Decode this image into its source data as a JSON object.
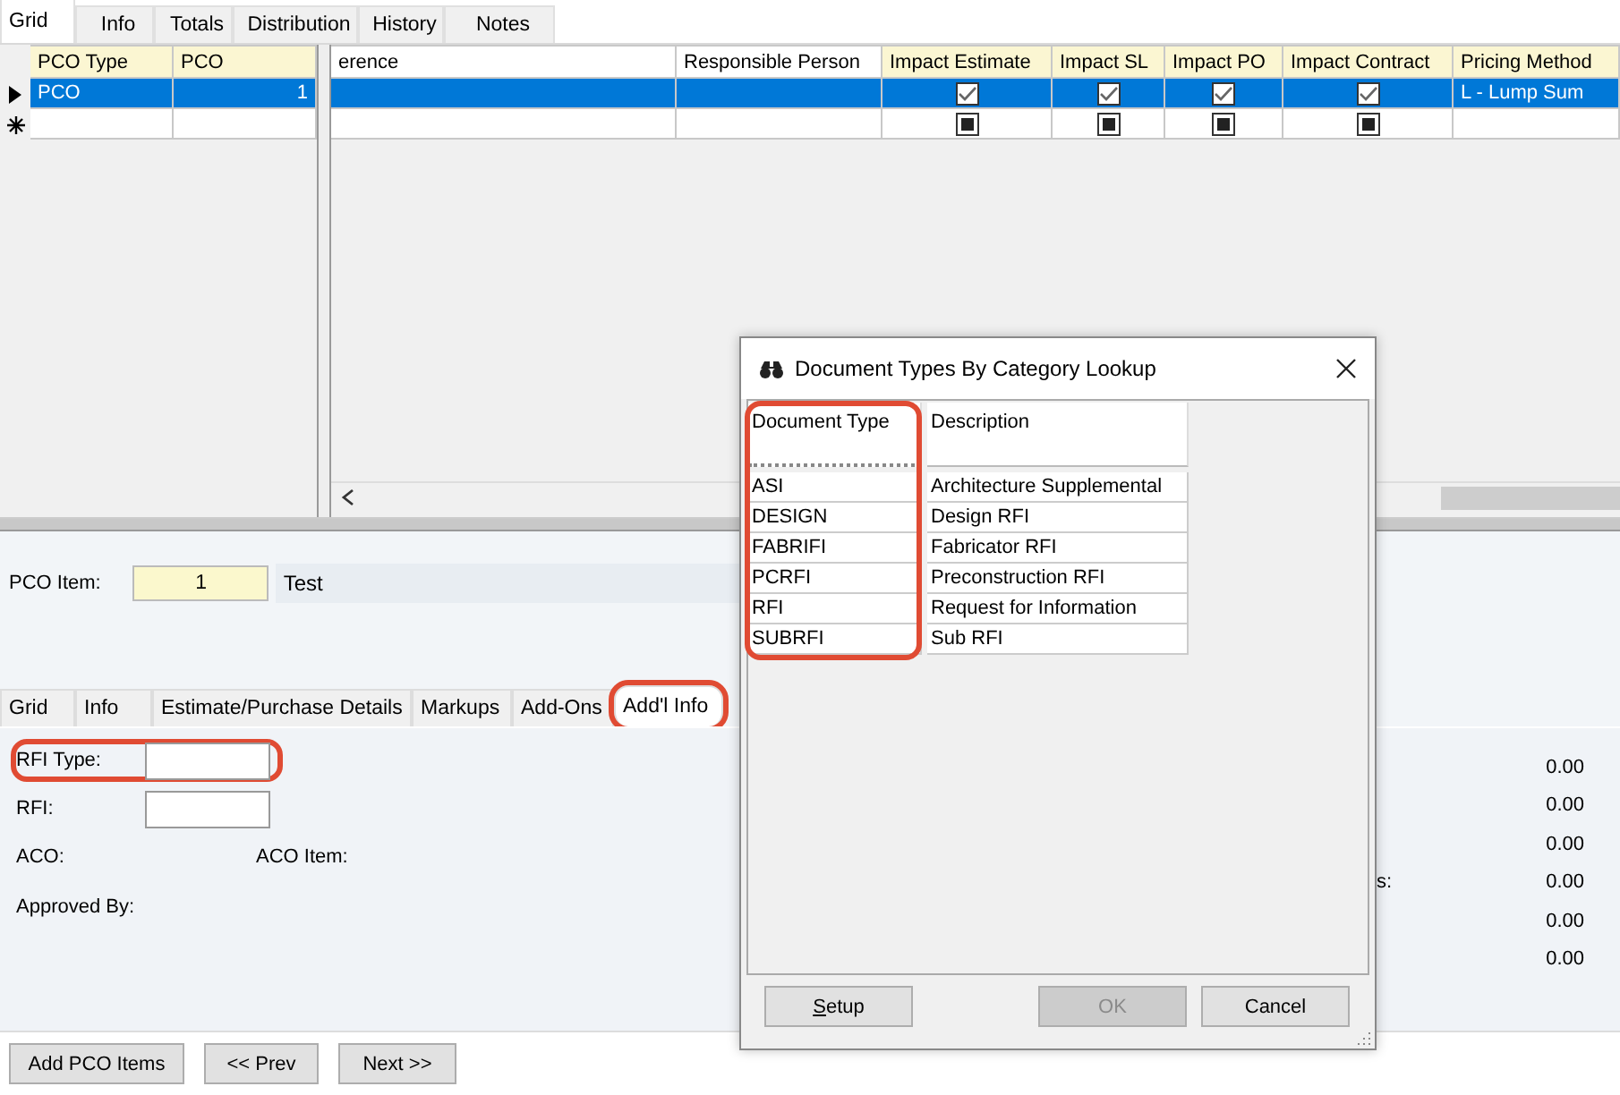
{
  "top_tabs": [
    {
      "label": "Grid",
      "selected": true
    },
    {
      "label": "Info",
      "selected": false
    },
    {
      "label": "Totals",
      "selected": false
    },
    {
      "label": "Distribution",
      "selected": false
    },
    {
      "label": "History",
      "selected": false
    },
    {
      "label": "Notes",
      "selected": false
    }
  ],
  "grid": {
    "frozen_columns": [
      "PCO Type",
      "PCO"
    ],
    "columns": [
      {
        "label": "erence",
        "kind": "text"
      },
      {
        "label": "Responsible Person",
        "kind": "text"
      },
      {
        "label": "Impact Estimate",
        "kind": "check"
      },
      {
        "label": "Impact SL",
        "kind": "check"
      },
      {
        "label": "Impact PO",
        "kind": "check"
      },
      {
        "label": "Impact Contract",
        "kind": "check"
      },
      {
        "label": "Pricing Method",
        "kind": "text"
      }
    ],
    "rows": [
      {
        "kind": "record",
        "selected": true,
        "pco_type": "PCO",
        "pco": "1",
        "checks": [
          {
            "checked": true
          },
          {
            "checked": true
          },
          {
            "checked": true
          },
          {
            "checked": true
          }
        ],
        "pricing_method": "L - Lump Sum"
      },
      {
        "kind": "new",
        "selected": false,
        "checks": [
          {
            "checked": false
          },
          {
            "checked": false
          },
          {
            "checked": false
          },
          {
            "checked": false
          }
        ]
      }
    ]
  },
  "pco_item": {
    "label": "PCO Item:",
    "value": "1",
    "description": "Test"
  },
  "detail_tabs": [
    {
      "label": "Grid",
      "selected": false,
      "highlighted": false
    },
    {
      "label": "Info",
      "selected": false,
      "highlighted": false
    },
    {
      "label": "Estimate/Purchase Details",
      "selected": false,
      "highlighted": false
    },
    {
      "label": "Markups",
      "selected": false,
      "highlighted": false
    },
    {
      "label": "Add-Ons",
      "selected": false,
      "highlighted": false
    },
    {
      "label": "Add'l Info",
      "selected": true,
      "highlighted": true
    }
  ],
  "fields": [
    {
      "label": "RFI Type:",
      "kind": "input",
      "highlighted": true
    },
    {
      "label": "RFI:",
      "kind": "input",
      "highlighted": false
    },
    {
      "label": "ACO:",
      "kind": "pair",
      "second_label": "ACO Item:"
    },
    {
      "label": "Approved By:",
      "kind": "label"
    }
  ],
  "amounts": [
    {
      "value": "0.00"
    },
    {
      "value": "0.00"
    },
    {
      "value": "0.00"
    },
    {
      "label": "s:",
      "value": "0.00"
    },
    {
      "value": "0.00"
    },
    {
      "value": "0.00"
    }
  ],
  "buttons": [
    "Add PCO Items",
    "<< Prev",
    "Next >>"
  ],
  "dialog": {
    "title": "Document Types By Category Lookup",
    "columns": [
      {
        "label": "Document Type",
        "highlighted": true
      },
      {
        "label": "Description",
        "highlighted": false
      }
    ],
    "rows": [
      [
        "ASI",
        "Architecture Supplemental"
      ],
      [
        "DESIGN",
        "Design RFI"
      ],
      [
        "FABRIFI",
        "Fabricator RFI"
      ],
      [
        "PCRFI",
        "Preconstruction RFI"
      ],
      [
        "RFI",
        "Request for Information"
      ],
      [
        "SUBRFI",
        "Sub RFI"
      ]
    ],
    "buttons": [
      {
        "label": "Setup",
        "disabled": false,
        "access_key": true
      },
      {
        "label": "OK",
        "disabled": true,
        "access_key": false
      },
      {
        "label": "Cancel",
        "disabled": false,
        "access_key": false
      }
    ]
  }
}
